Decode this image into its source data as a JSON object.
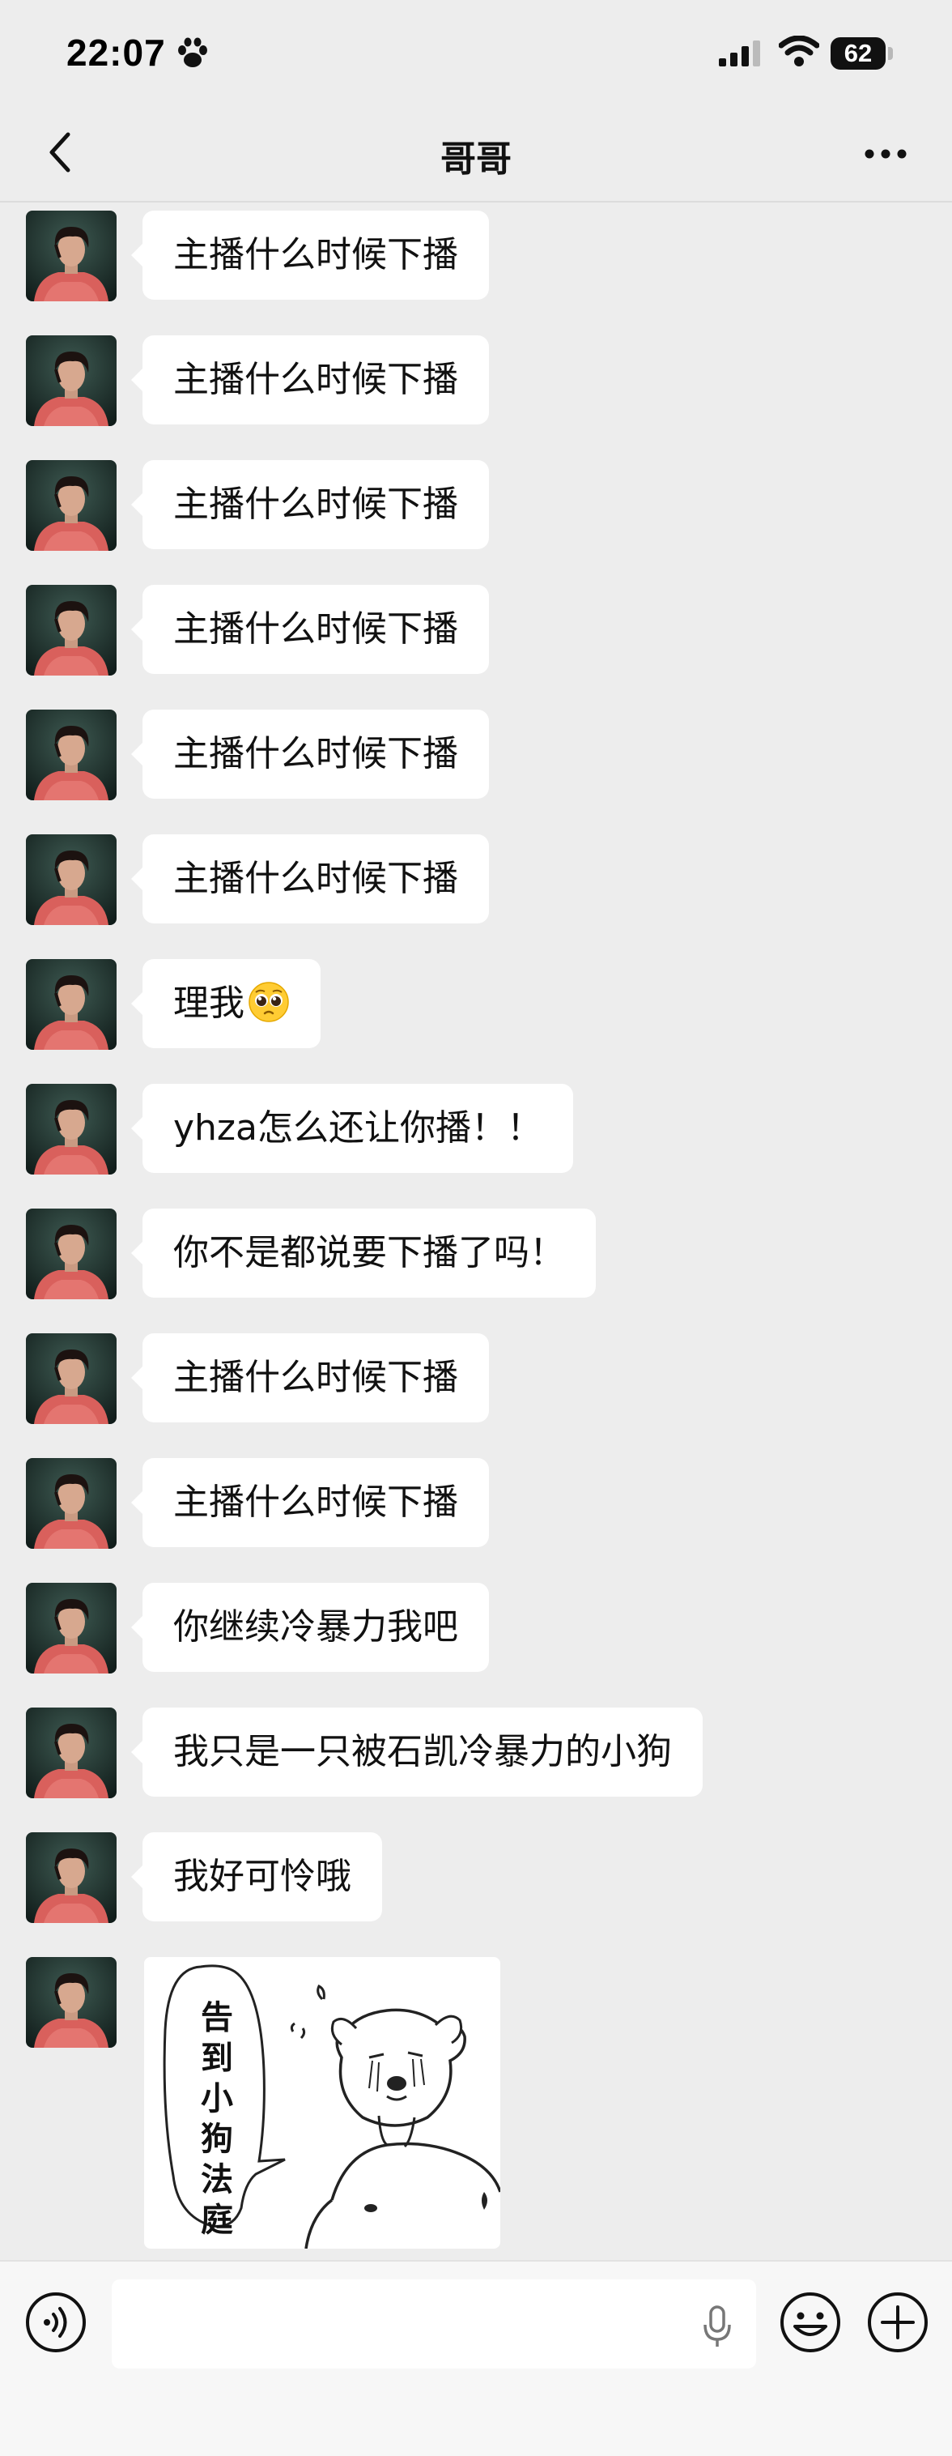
{
  "status": {
    "time": "22:07",
    "battery": "62",
    "icons": [
      "paw-icon",
      "signal-icon",
      "wifi-icon",
      "battery-icon"
    ]
  },
  "nav": {
    "title": "哥哥",
    "icons": [
      "chevron-left-icon",
      "more-icon"
    ]
  },
  "messages": [
    {
      "text": "主播什么时候下播"
    },
    {
      "text": "主播什么时候下播"
    },
    {
      "text": "主播什么时候下播"
    },
    {
      "text": "主播什么时候下播"
    },
    {
      "text": "主播什么时候下播"
    },
    {
      "text": "主播什么时候下播"
    },
    {
      "text": "理我",
      "emoji": "pleading-face"
    },
    {
      "text": "yhza怎么还让你播！！"
    },
    {
      "text": "你不是都说要下播了吗！"
    },
    {
      "text": "主播什么时候下播"
    },
    {
      "text": "主播什么时候下播"
    },
    {
      "text": "你继续冷暴力我吧"
    },
    {
      "text": "我只是一只被石凯冷暴力的小狗"
    },
    {
      "text": "我好可怜哦"
    }
  ],
  "sticker": {
    "text": "告到小狗法庭",
    "icon": "crying-dog-sticker"
  },
  "input": {
    "placeholder": "",
    "icons": [
      "voice-icon",
      "mic-icon",
      "emoji-icon",
      "plus-icon"
    ]
  }
}
